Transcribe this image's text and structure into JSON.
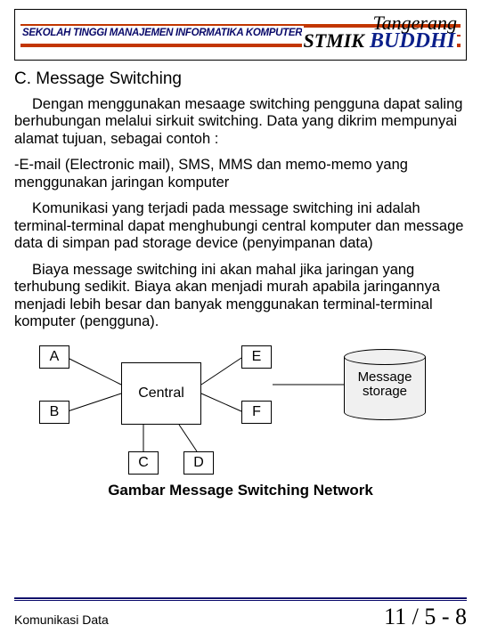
{
  "banner": {
    "institution": "SEKOLAH TINGGI MANAJEMEN INFORMATIKA KOMPUTER",
    "location": "Tangerang",
    "abbrev": "STMIK",
    "brand": "BUDDHI"
  },
  "section": {
    "title": "C. Message Switching",
    "p1": "Dengan menggunakan mesaage switching pengguna dapat saling berhubungan melalui sirkuit switching. Data yang dikrim mempunyai alamat tujuan, sebagai contoh :",
    "p2": "-E-mail (Electronic mail), SMS, MMS dan memo-memo yang menggunakan jaringan komputer",
    "p3": "Komunikasi yang terjadi pada message switching ini adalah terminal-terminal dapat menghubungi central komputer dan message data di simpan pad storage device (penyimpanan data)",
    "p4": "Biaya message switching ini akan mahal jika jaringan yang terhubung sedikit. Biaya akan menjadi murah apabila jaringannya menjadi lebih besar dan banyak menggunakan terminal-terminal komputer (pengguna)."
  },
  "diagram": {
    "A": "A",
    "B": "B",
    "C": "C",
    "D": "D",
    "E": "E",
    "F": "F",
    "central": "Central",
    "storage_l1": "Message",
    "storage_l2": "storage",
    "caption": "Gambar Message Switching Network"
  },
  "footer": {
    "course": "Komunikasi Data",
    "page": "11 / 5 - 8"
  }
}
